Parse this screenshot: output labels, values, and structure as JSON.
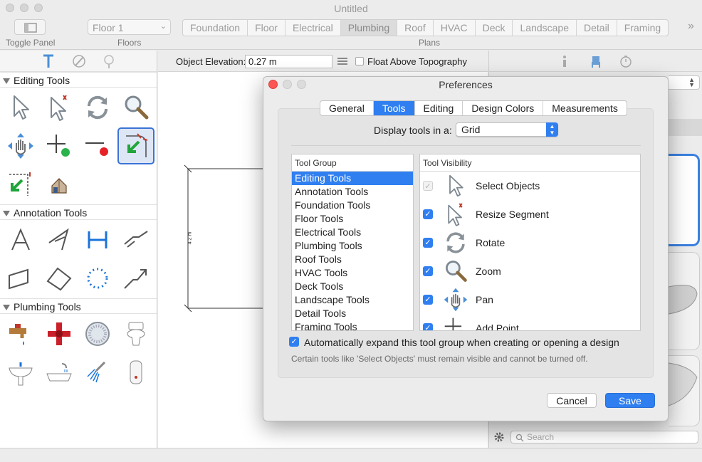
{
  "window": {
    "title": "Untitled"
  },
  "toolbar": {
    "toggle_panel_label": "Toggle Panel",
    "floor_select": "Floor 1",
    "floors_label": "Floors",
    "plans_label": "Plans",
    "more": "»",
    "plan_tabs": [
      "Foundation",
      "Floor",
      "Electrical",
      "Plumbing",
      "Roof",
      "HVAC",
      "Deck",
      "Landscape",
      "Detail",
      "Framing"
    ],
    "active_plan": "Plumbing"
  },
  "left_panel": {
    "sections": [
      {
        "title": "Editing Tools"
      },
      {
        "title": "Annotation Tools"
      },
      {
        "title": "Plumbing Tools"
      }
    ]
  },
  "elevation": {
    "label": "Object Elevation:",
    "value": "0.27 m",
    "float_label": "Float Above Topography"
  },
  "canvas": {
    "dimension": "4.2 m"
  },
  "right_panel": {
    "search_placeholder": "Search"
  },
  "dialog": {
    "title": "Preferences",
    "tabs": [
      "General",
      "Tools",
      "Editing",
      "Design Colors",
      "Measurements"
    ],
    "active_tab": "Tools",
    "display_label": "Display tools in a:",
    "display_value": "Grid",
    "tool_group_header": "Tool Group",
    "tool_groups": [
      "Editing Tools",
      "Annotation Tools",
      "Foundation Tools",
      "Floor Tools",
      "Electrical Tools",
      "Plumbing Tools",
      "Roof Tools",
      "HVAC Tools",
      "Deck Tools",
      "Landscape Tools",
      "Detail Tools",
      "Framing Tools"
    ],
    "selected_group": "Editing Tools",
    "visibility_header": "Tool Visibility",
    "tools": [
      {
        "name": "Select Objects",
        "checked": true,
        "disabled": true
      },
      {
        "name": "Resize Segment",
        "checked": true,
        "disabled": false
      },
      {
        "name": "Rotate",
        "checked": true,
        "disabled": false
      },
      {
        "name": "Zoom",
        "checked": true,
        "disabled": false
      },
      {
        "name": "Pan",
        "checked": true,
        "disabled": false
      },
      {
        "name": "Add Point",
        "checked": true,
        "disabled": false
      }
    ],
    "auto_expand_label": "Automatically expand this tool group when creating or opening a design",
    "note": "Certain tools like 'Select Objects' must remain visible and cannot be turned off.",
    "cancel_label": "Cancel",
    "save_label": "Save"
  },
  "colors": {
    "accent": "#2f7ff0",
    "selection_border": "#3b73d6"
  }
}
